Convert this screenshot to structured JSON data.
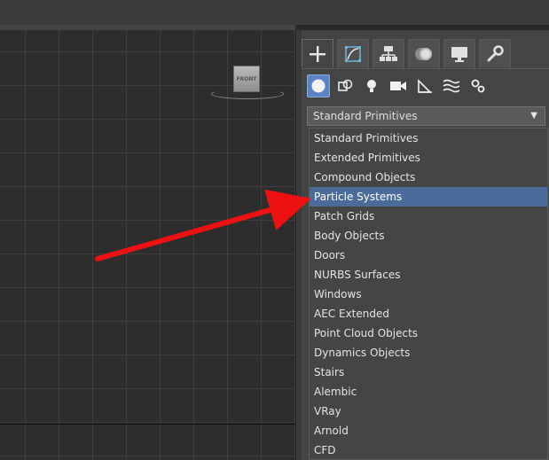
{
  "viewport": {
    "viewcube_label": "FRONT"
  },
  "panel": {
    "tabs": [
      {
        "name": "create",
        "icon": "plus-icon",
        "active": true
      },
      {
        "name": "modify",
        "icon": "modify-curve-icon",
        "active": false
      },
      {
        "name": "hierarchy",
        "icon": "hierarchy-icon",
        "active": false
      },
      {
        "name": "motion",
        "icon": "motion-icon",
        "active": false
      },
      {
        "name": "display",
        "icon": "display-monitor-icon",
        "active": false
      },
      {
        "name": "utilities",
        "icon": "wrench-icon",
        "active": false
      }
    ],
    "sub_icons": [
      {
        "name": "geometry",
        "icon": "sphere-icon",
        "active": true
      },
      {
        "name": "shapes",
        "icon": "shapes-icon",
        "active": false
      },
      {
        "name": "lights",
        "icon": "bulb-icon",
        "active": false
      },
      {
        "name": "cameras",
        "icon": "camera-icon",
        "active": false
      },
      {
        "name": "helpers",
        "icon": "tape-measure-icon",
        "active": false
      },
      {
        "name": "spacewarps",
        "icon": "wave-icon",
        "active": false
      },
      {
        "name": "systems",
        "icon": "gears-icon",
        "active": false
      }
    ],
    "dropdown": {
      "selected": "Standard Primitives"
    },
    "options": [
      "Standard Primitives",
      "Extended Primitives",
      "Compound Objects",
      "Particle Systems",
      "Patch Grids",
      "Body Objects",
      "Doors",
      "NURBS Surfaces",
      "Windows",
      "AEC Extended",
      "Point Cloud Objects",
      "Dynamics Objects",
      "Stairs",
      "Alembic",
      "VRay",
      "Arnold",
      "CFD"
    ],
    "highlighted_option": "Particle Systems"
  },
  "colors": {
    "highlight": "#4b6c9a",
    "active_icon": "#5c84c4",
    "arrow": "#ee1111"
  }
}
